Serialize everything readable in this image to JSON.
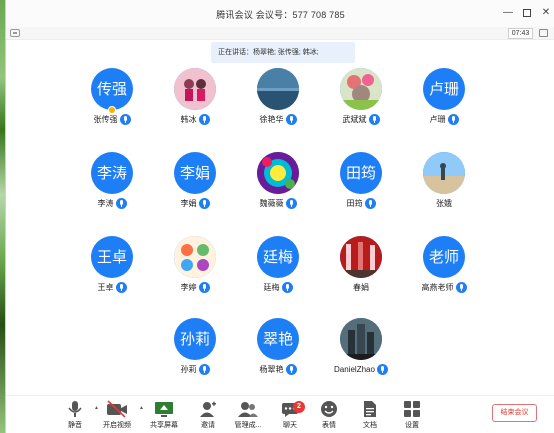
{
  "window": {
    "title": "腾讯会议  会议号：577 708 785",
    "timer": "07:43"
  },
  "speaking_banner": "正在讲话：杨翠艳; 张传强; 韩冰;",
  "participants": [
    {
      "avatar_text": "传强",
      "name": "张传强",
      "photo": false,
      "host": true
    },
    {
      "avatar_text": "",
      "name": "韩冰",
      "photo": true,
      "photo_style": "pink-kids"
    },
    {
      "avatar_text": "",
      "name": "徐艳华",
      "photo": true,
      "photo_style": "sea"
    },
    {
      "avatar_text": "",
      "name": "武斌斌",
      "photo": true,
      "photo_style": "flowers"
    },
    {
      "avatar_text": "卢珊",
      "name": "卢珊",
      "photo": false
    },
    {
      "avatar_text": "李涛",
      "name": "李涛",
      "photo": false
    },
    {
      "avatar_text": "李娟",
      "name": "李娟",
      "photo": false
    },
    {
      "avatar_text": "",
      "name": "魏薇薇",
      "photo": true,
      "photo_style": "colorful"
    },
    {
      "avatar_text": "田筠",
      "name": "田筠",
      "photo": false
    },
    {
      "avatar_text": "",
      "name": "张娥",
      "photo": true,
      "photo_style": "beach"
    },
    {
      "avatar_text": "王卓",
      "name": "王卓",
      "photo": false
    },
    {
      "avatar_text": "",
      "name": "李婷",
      "photo": true,
      "photo_style": "cartoon"
    },
    {
      "avatar_text": "廷梅",
      "name": "廷梅",
      "photo": false
    },
    {
      "avatar_text": "",
      "name": "春娟",
      "photo": true,
      "photo_style": "flags"
    },
    {
      "avatar_text": "老师",
      "name": "高燕老师",
      "photo": false
    },
    {
      "avatar_text": "孙莉",
      "name": "孙莉",
      "photo": false
    },
    {
      "avatar_text": "翠艳",
      "name": "杨翠艳",
      "photo": false
    },
    {
      "avatar_text": "",
      "name": "DanielZhao",
      "photo": true,
      "photo_style": "city"
    }
  ],
  "bottom_bar": {
    "mute": "静音",
    "video": "开启视频",
    "share": "共享屏幕",
    "invite": "邀请",
    "members": "管理成...",
    "chat": "聊天",
    "chat_badge": "2",
    "reactions": "表情",
    "docs": "文档",
    "settings": "设置",
    "end": "结束会议"
  },
  "colors": {
    "accent": "#1e7ef5",
    "end": "#e53935"
  }
}
